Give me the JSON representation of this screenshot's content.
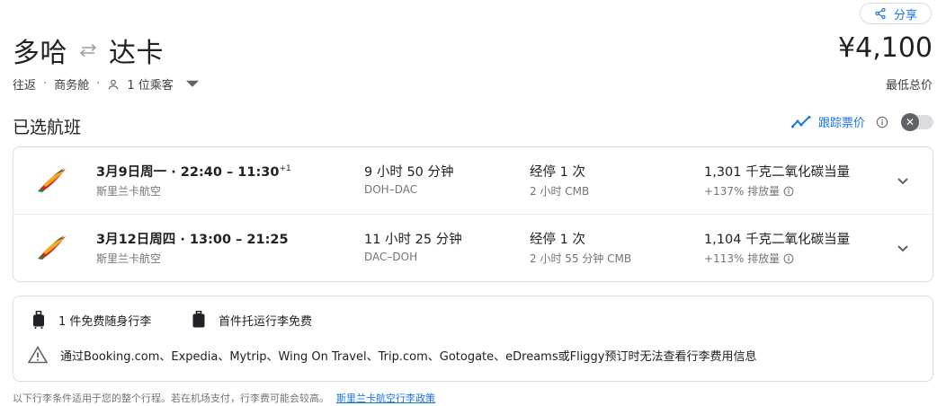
{
  "share": {
    "label": "分享",
    "icon": "share-icon"
  },
  "trip": {
    "origin": "多哈",
    "destination": "达卡",
    "type": "往返",
    "cabin": "商务舱",
    "passengers": "1 位乘客"
  },
  "price": {
    "value": "¥4,100",
    "label": "最低总价"
  },
  "selected": {
    "title": "已选航班",
    "track_label": "跟踪票价",
    "track_enabled": false
  },
  "flights": [
    {
      "date": "3月9日周一",
      "times": "22:40 – 11:30",
      "day_offset": "+1",
      "airline": "斯里兰卡航空",
      "duration": "9 小时 50 分钟",
      "route": "DOH–DAC",
      "stops": "经停 1 次",
      "layover": "2 小时 CMB",
      "emissions": "1,301 千克二氧化碳当量",
      "emission_pct": "+137% 排放量"
    },
    {
      "date": "3月12日周四",
      "times": "13:00 – 21:25",
      "day_offset": "",
      "airline": "斯里兰卡航空",
      "duration": "11 小时 25 分钟",
      "route": "DAC–DOH",
      "stops": "经停 1 次",
      "layover": "2 小时 55 分钟 CMB",
      "emissions": "1,104 千克二氧化碳当量",
      "emission_pct": "+113% 排放量"
    }
  ],
  "baggage": {
    "carry_on": "1 件免费随身行李",
    "checked": "首件托运行李免费",
    "warning": "通过Booking.com、Expedia、Mytrip、Wing On Travel、Trip.com、Gotogate、eDreams或Fliggy预订时无法查看行李费用信息"
  },
  "footer": {
    "text": "以下行李条件适用于您的整个行程。若在机场支付，行李费可能会较高。",
    "link": "斯里兰卡航空行李政策"
  },
  "colors": {
    "accent": "#1a73e8",
    "text": "#202124",
    "muted": "#70757a",
    "border": "#dadce0"
  }
}
